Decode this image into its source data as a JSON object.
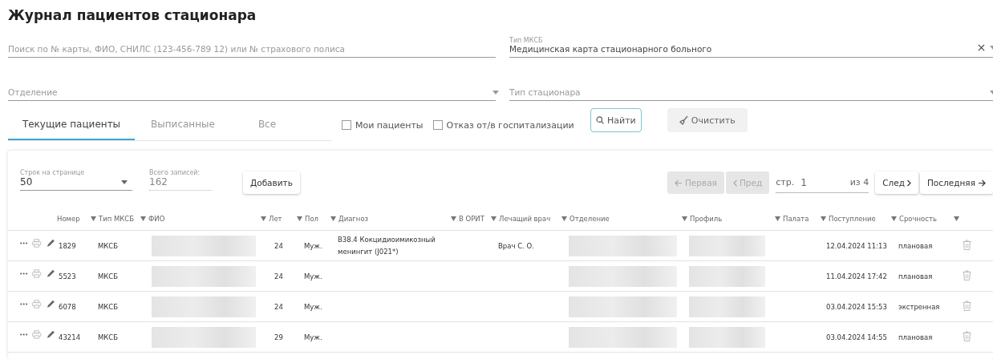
{
  "title": "Журнал пациентов стационара",
  "search": {
    "placeholder": "Поиск по № карты, ФИО, СНИЛС (123-456-789 12) или № страхового полиса"
  },
  "mksb_type": {
    "label": "Тип МКСБ",
    "value": "Медицинская карта стационарного больного",
    "clearable": true
  },
  "department": {
    "placeholder": "Отделение"
  },
  "hospital_type": {
    "placeholder": "Тип стационара"
  },
  "tabs": [
    {
      "label": "Текущие пациенты",
      "selected": true
    },
    {
      "label": "Выписанные",
      "selected": false
    },
    {
      "label": "Все",
      "selected": false
    }
  ],
  "checkboxes": [
    {
      "label": "Мои пациенты",
      "checked": false
    },
    {
      "label": "Отказ от/в госпитализации",
      "checked": false
    }
  ],
  "search_button": "Найти",
  "clear_button": "Очистить",
  "rows_per_page": {
    "label": "Строк на странице",
    "value": "50"
  },
  "total": {
    "label": "Всего записей:",
    "value": "162"
  },
  "add_button": "Добавить",
  "pager": {
    "first": {
      "label": "Первая",
      "disabled": true
    },
    "prev": {
      "label": "Пред",
      "disabled": true
    },
    "page_label": "стр.",
    "page": "1",
    "of": "из 4",
    "next": {
      "label": "След",
      "disabled": false
    },
    "last": {
      "label": "Последняя",
      "disabled": false
    }
  },
  "columns": [
    {
      "label": "Номер",
      "filter": false
    },
    {
      "label": "Тип МКСБ",
      "filter": true
    },
    {
      "label": "ФИО",
      "filter": true
    },
    {
      "label": "Лет",
      "filter": true
    },
    {
      "label": "Пол",
      "filter": true
    },
    {
      "label": "Диагноз",
      "filter": true
    },
    {
      "label": "В ОРИТ",
      "filter": true
    },
    {
      "label": "Лечащий врач",
      "filter": true
    },
    {
      "label": "Отделение",
      "filter": true
    },
    {
      "label": "Профиль",
      "filter": true
    },
    {
      "label": "Палата",
      "filter": true
    },
    {
      "label": "Поступление",
      "filter": true
    },
    {
      "label": "Срочность",
      "filter": true
    },
    {
      "filter": true
    }
  ],
  "rows": [
    {
      "number": "1829",
      "type": "МКСБ",
      "fio": {
        "kind": "redacted"
      },
      "age": "24",
      "sex": "Муж.",
      "diagnosis": "B38.4 Кокцидиоимикозный менингит (J021*)",
      "doctor": "Врач С. О.",
      "department": {
        "kind": "redacted"
      },
      "profile": {
        "kind": "redacted"
      },
      "admission": "12.04.2024 11:13",
      "urgency": "плановая"
    },
    {
      "number": "5523",
      "type": "МКСБ",
      "fio": {
        "kind": "redacted"
      },
      "age": "24",
      "sex": "Муж.",
      "department": {
        "kind": "redacted"
      },
      "profile": {
        "kind": "redacted"
      },
      "admission": "11.04.2024 17:42",
      "urgency": "плановая"
    },
    {
      "number": "6078",
      "type": "МКСБ",
      "fio": {
        "kind": "redacted"
      },
      "age": "24",
      "sex": "Муж.",
      "department": {
        "kind": "redacted"
      },
      "profile": {
        "kind": "redacted"
      },
      "admission": "03.04.2024 15:53",
      "urgency": "экстренная"
    },
    {
      "number": "43214",
      "type": "МКСБ",
      "fio": {
        "kind": "redacted"
      },
      "age": "29",
      "sex": "Муж.",
      "department": {
        "kind": "redacted"
      },
      "profile": {
        "kind": "redacted"
      },
      "admission": "03.04.2024 14:55",
      "urgency": "плановая"
    }
  ]
}
